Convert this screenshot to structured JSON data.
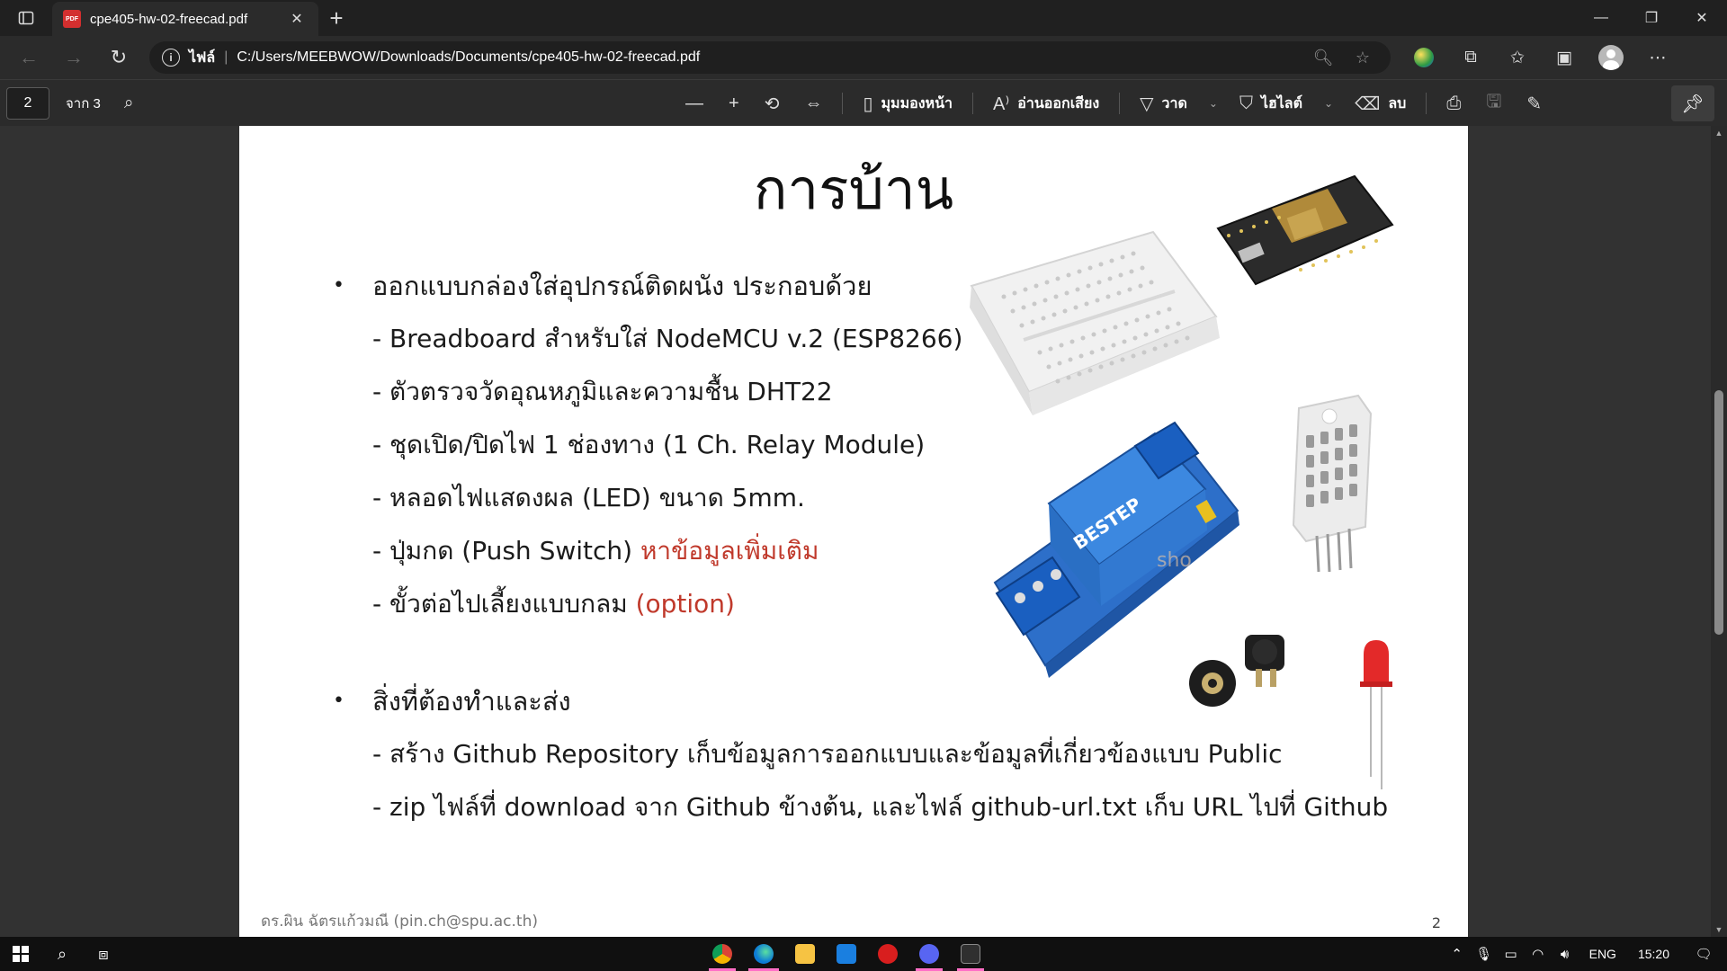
{
  "browser": {
    "tab_title": "cpe405-hw-02-freecad.pdf",
    "address_label": "ไฟล์",
    "address_url": "C:/Users/MEEBWOW/Downloads/Documents/cpe405-hw-02-freecad.pdf",
    "favicon_text": "PDF"
  },
  "pdf_toolbar": {
    "page_number": "2",
    "page_of": "จาก 3",
    "page_view_label": "มุมมองหน้า",
    "read_aloud_label": "อ่านออกเสียง",
    "draw_label": "วาด",
    "highlight_label": "ไฮไลต์",
    "erase_label": "ลบ"
  },
  "slide": {
    "title": "การบ้าน",
    "section1": {
      "heading": "ออกแบบกล่องใส่อุปกรณ์ติดผนัง ประกอบด้วย",
      "items": [
        "- Breadboard สำหรับใส่ NodeMCU v.2 (ESP8266)",
        "- ตัวตรวจวัดอุณหภูมิและความชื้น DHT22",
        "- ชุดเปิด/ปิดไฟ 1 ช่องทาง (1 Ch. Relay Module)",
        "- หลอดไฟแสดงผล (LED) ขนาด 5mm."
      ],
      "push_switch_prefix": "- ปุ่มกด (Push Switch) ",
      "push_switch_accent": "หาข้อมูลเพิ่มเติม",
      "connector_prefix": "- ขั้วต่อไปเลี้ยงแบบกลม ",
      "connector_accent": "(option)"
    },
    "section2": {
      "heading": "สิ่งที่ต้องทำและส่ง",
      "items": [
        "- สร้าง Github Repository เก็บข้อมูลการออกแบบและข้อมูลที่เกี่ยวข้องแบบ Public",
        "- zip ไฟล์ที่ download จาก Github ข้างต้น, และไฟล์ github-url.txt เก็บ URL ไปที่ Github"
      ]
    },
    "relay_brand": "BESTEP",
    "watermark": "sho",
    "footer_author": "ดร.ผิน ฉัตรแก้วมณี (pin.ch@spu.ac.th)",
    "footer_page": "2"
  },
  "taskbar": {
    "language": "ENG",
    "time": "15:20"
  },
  "colors": {
    "accent_red": "#c0392b",
    "taskbar_indicator": "#ff6ec7"
  }
}
